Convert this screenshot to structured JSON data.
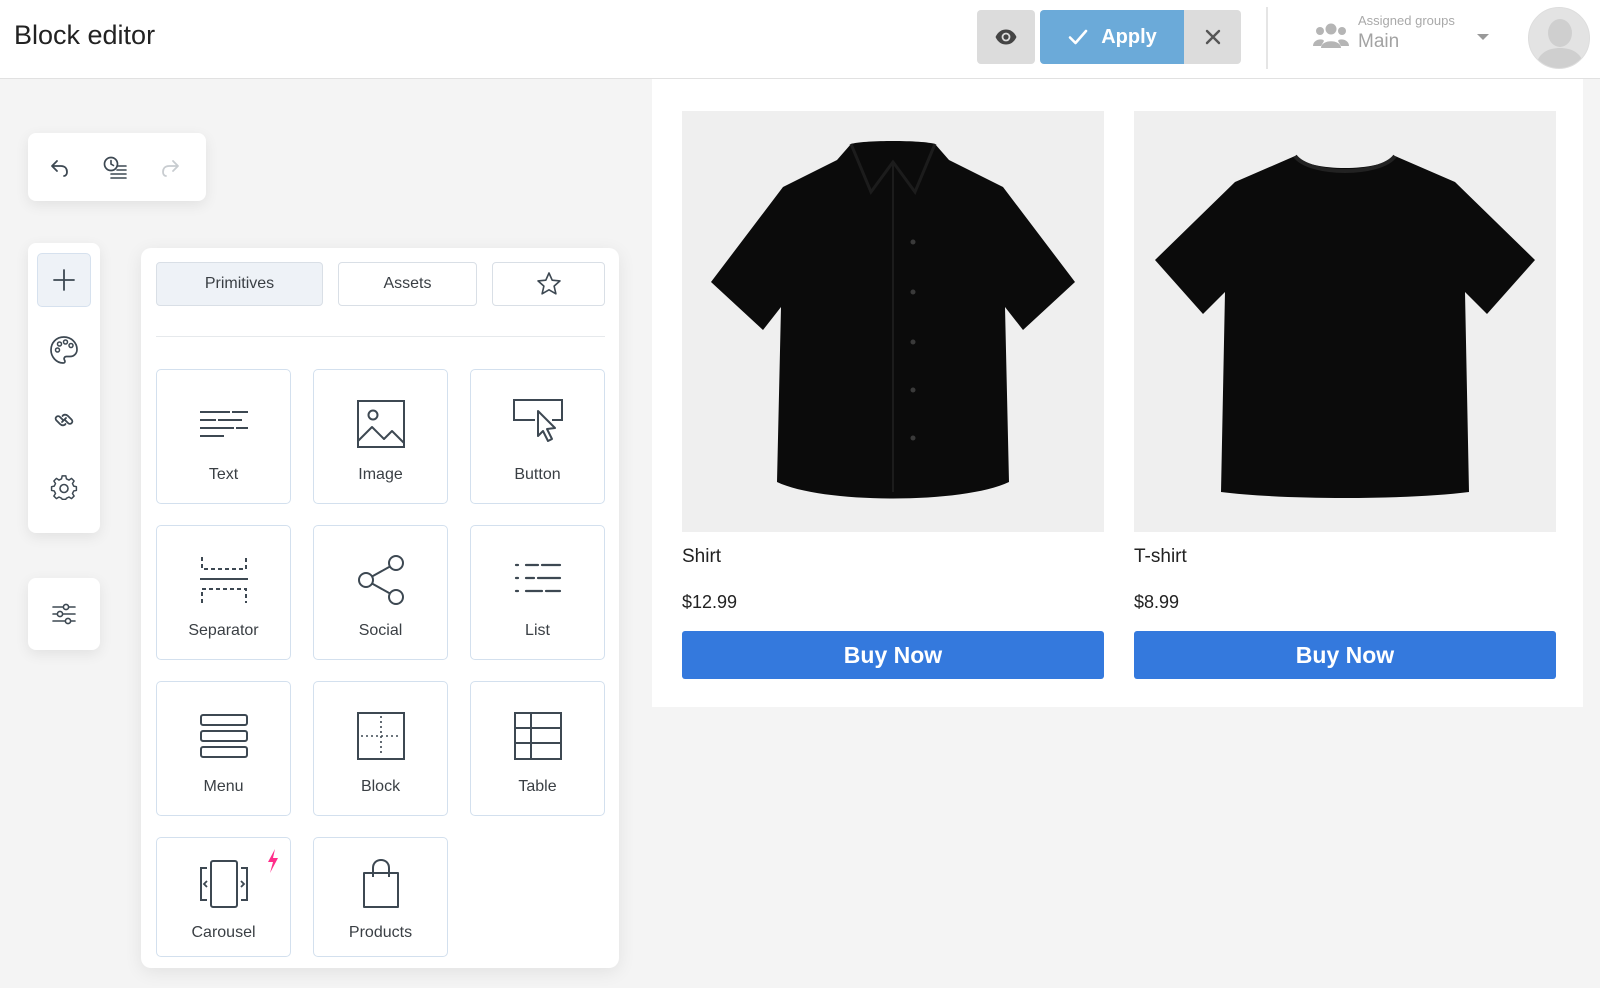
{
  "header": {
    "title": "Block editor",
    "apply_label": "Apply",
    "groups_label": "Assigned groups",
    "groups_value": "Main"
  },
  "history": {
    "icons": [
      "undo-icon",
      "history-icon",
      "redo-icon"
    ]
  },
  "sidebar": {
    "icons": [
      "plus-icon",
      "palette-icon",
      "link-icon",
      "gear-icon",
      "sliders-icon"
    ]
  },
  "panel": {
    "tabs": [
      {
        "label": "Primitives",
        "active": true
      },
      {
        "label": "Assets",
        "active": false
      },
      {
        "label": "",
        "icon": "star-icon",
        "active": false
      }
    ],
    "blocks": [
      {
        "label": "Text",
        "icon": "text-icon"
      },
      {
        "label": "Image",
        "icon": "image-icon"
      },
      {
        "label": "Button",
        "icon": "button-cursor-icon"
      },
      {
        "label": "Separator",
        "icon": "separator-icon"
      },
      {
        "label": "Social",
        "icon": "share-icon"
      },
      {
        "label": "List",
        "icon": "list-icon"
      },
      {
        "label": "Menu",
        "icon": "menu-icon"
      },
      {
        "label": "Block",
        "icon": "block-icon"
      },
      {
        "label": "Table",
        "icon": "table-icon"
      },
      {
        "label": "Carousel",
        "icon": "carousel-icon",
        "badge": "bolt-icon"
      },
      {
        "label": "Products",
        "icon": "shopping-bag-icon"
      }
    ]
  },
  "products": [
    {
      "name": "Shirt",
      "price": "$12.99",
      "button": "Buy Now"
    },
    {
      "name": "T-shirt",
      "price": "$8.99",
      "button": "Buy Now"
    }
  ],
  "colors": {
    "accent": "#3479dd",
    "apply": "#6baad9",
    "tile_border": "#d3e0ee",
    "icon": "#3d4852",
    "bolt": "#ff2d8a"
  }
}
